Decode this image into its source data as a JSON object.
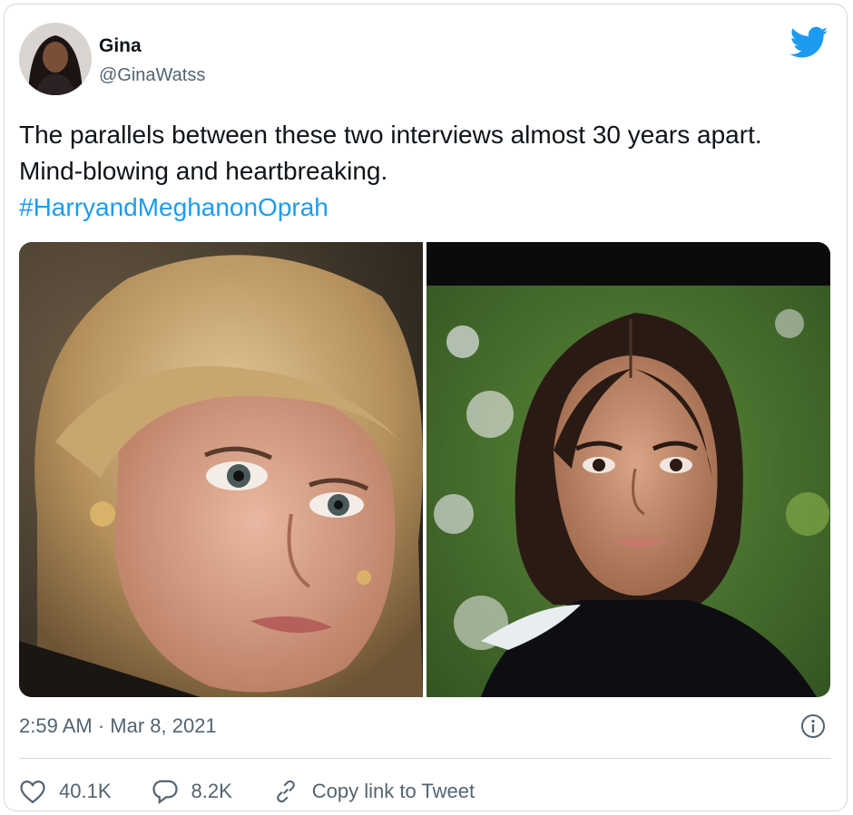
{
  "author": {
    "name": "Gina",
    "handle": "@GinaWatss"
  },
  "tweet": {
    "text": "The parallels between these two interviews almost 30 years apart. Mind-blowing and heartbreaking.",
    "hashtag": "#HarryandMeghanonOprah",
    "timestamp": "2:59 AM · Mar 8, 2021"
  },
  "actions": {
    "likes": "40.1K",
    "replies": "8.2K",
    "copy_link": "Copy link to Tweet"
  },
  "icons": [
    "avatar",
    "twitter-bird-icon",
    "info-icon",
    "heart-icon",
    "reply-icon",
    "link-icon"
  ],
  "colors": {
    "accent": "#1d9bf0",
    "secondary_text": "#536471",
    "border": "#cfd9de"
  }
}
